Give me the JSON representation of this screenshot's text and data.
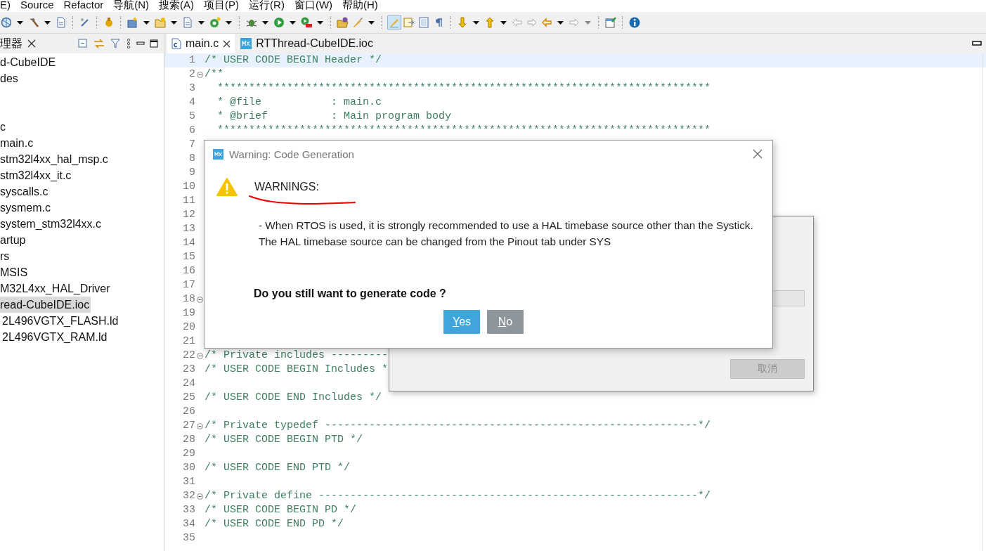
{
  "menu": [
    "E)",
    "Source",
    "Refactor",
    "导航(N)",
    "搜索(A)",
    "项目(P)",
    "运行(R)",
    "窗口(W)",
    "帮助(H)"
  ],
  "explorer": {
    "tab": "理器",
    "items": [
      {
        "label": "d-CubeIDE",
        "selected": false
      },
      {
        "label": "des",
        "selected": false
      },
      {
        "label": "c",
        "selected": false
      },
      {
        "label": "main.c",
        "selected": false
      },
      {
        "label": "stm32l4xx_hal_msp.c",
        "selected": false
      },
      {
        "label": "stm32l4xx_it.c",
        "selected": false
      },
      {
        "label": "syscalls.c",
        "selected": false
      },
      {
        "label": "sysmem.c",
        "selected": false
      },
      {
        "label": "system_stm32l4xx.c",
        "selected": false
      },
      {
        "label": "artup",
        "selected": false
      },
      {
        "label": "rs",
        "selected": false
      },
      {
        "label": "MSIS",
        "selected": false
      },
      {
        "label": "M32L4xx_HAL_Driver",
        "selected": false
      },
      {
        "label": "read-CubeIDE.ioc",
        "selected": true
      },
      {
        "label": "2L496VGTX_FLASH.ld",
        "selected": false
      },
      {
        "label": "2L496VGTX_RAM.ld",
        "selected": false
      }
    ]
  },
  "editor": {
    "tabs": [
      {
        "label": "main.c",
        "selected": true,
        "kind": "c-file"
      },
      {
        "label": "RTThread-CubeIDE.ioc",
        "selected": false,
        "kind": "mx"
      }
    ],
    "lines": [
      {
        "number": "1",
        "text": "/* USER CODE BEGIN Header */",
        "fold": false,
        "current": true
      },
      {
        "number": "2",
        "text": "/**",
        "fold": true,
        "current": false
      },
      {
        "number": "3",
        "text": "  ******************************************************************************",
        "fold": false,
        "current": false
      },
      {
        "number": "4",
        "text": "  * @file           : main.c",
        "fold": false,
        "current": false
      },
      {
        "number": "5",
        "text": "  * @brief          : Main program body",
        "fold": false,
        "current": false
      },
      {
        "number": "6",
        "text": "  ******************************************************************************",
        "fold": false,
        "current": false
      },
      {
        "number": "7",
        "fold": false,
        "current": false
      },
      {
        "number": "8",
        "fold": false,
        "current": false
      },
      {
        "number": "9",
        "fold": false,
        "current": false
      },
      {
        "number": "10",
        "fold": false,
        "current": false
      },
      {
        "number": "11",
        "fold": false,
        "current": false
      },
      {
        "number": "12",
        "fold": false,
        "current": false
      },
      {
        "number": "13",
        "fold": false,
        "current": false
      },
      {
        "number": "14",
        "fold": false,
        "current": false
      },
      {
        "number": "15",
        "fold": false,
        "current": false
      },
      {
        "number": "16",
        "fold": false,
        "current": false
      },
      {
        "number": "17",
        "fold": false,
        "current": false
      },
      {
        "number": "18",
        "fold": true,
        "current": false
      },
      {
        "number": "19",
        "fold": false,
        "current": false
      },
      {
        "number": "20",
        "fold": false,
        "current": false
      },
      {
        "number": "21",
        "fold": false,
        "current": false
      },
      {
        "number": "22",
        "text": "/* Private includes ---------",
        "fold": true,
        "current": false
      },
      {
        "number": "23",
        "text": "/* USER CODE BEGIN Includes *",
        "fold": false,
        "current": false
      },
      {
        "number": "24",
        "fold": false,
        "current": false
      },
      {
        "number": "25",
        "text": "/* USER CODE END Includes */",
        "fold": false,
        "current": false
      },
      {
        "number": "26",
        "fold": false,
        "current": false
      },
      {
        "number": "27",
        "text": "/* Private typedef -----------------------------------------------------------*/",
        "fold": true,
        "current": false
      },
      {
        "number": "28",
        "text": "/* USER CODE BEGIN PTD */",
        "fold": false,
        "current": false
      },
      {
        "number": "29",
        "fold": false,
        "current": false
      },
      {
        "number": "30",
        "text": "/* USER CODE END PTD */",
        "fold": false,
        "current": false
      },
      {
        "number": "31",
        "fold": false,
        "current": false
      },
      {
        "number": "32",
        "text": "/* Private define ------------------------------------------------------------*/",
        "fold": true,
        "current": false
      },
      {
        "number": "33",
        "text": "/* USER CODE BEGIN PD */",
        "fold": false,
        "current": false
      },
      {
        "number": "34",
        "text": "/* USER CODE END PD */",
        "fold": false,
        "current": false
      },
      {
        "number": "35",
        "fold": false,
        "current": false
      }
    ]
  },
  "dialog": {
    "title": "Warning: Code Generation",
    "heading": "WARNINGS:",
    "message": [
      "- When RTOS is used, it is strongly recommended to use a HAL timebase source other than the Systick.",
      "The HAL timebase source can be changed from the Pinout tab under SYS"
    ],
    "question": "Do you still want to generate code ?",
    "buttons": [
      {
        "label": "Yes",
        "kind": "primary"
      },
      {
        "label": "No",
        "kind": "secondary"
      }
    ]
  },
  "background_dialog": {
    "cancel_button": {
      "label": "取消",
      "disabled": true
    }
  }
}
